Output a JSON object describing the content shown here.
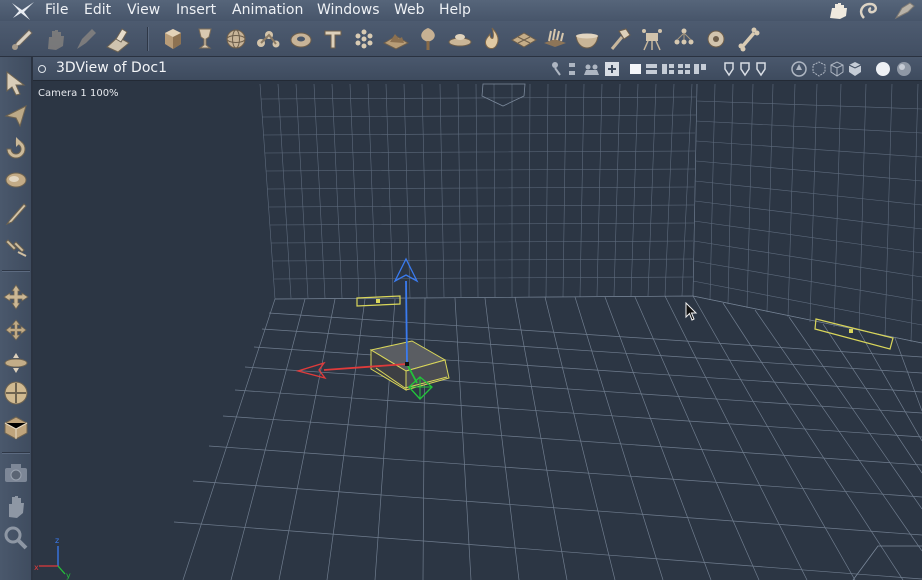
{
  "app": {
    "menus": [
      "File",
      "Edit",
      "View",
      "Insert",
      "Animation",
      "Windows",
      "Web",
      "Help"
    ]
  },
  "toolbar": {
    "left_tools": [
      "brush-icon",
      "hand-icon",
      "gesture-icon",
      "pen-stamp-icon"
    ],
    "primitive_tools": [
      "cube-icon",
      "goblet-icon",
      "sphere-icon",
      "joint-chain-icon",
      "torus-icon",
      "text-icon",
      "particle-icon",
      "terrain-icon",
      "tree-icon",
      "platter-icon",
      "fire-icon",
      "tile-icon",
      "fern-icon",
      "bowl-icon",
      "hammer-icon",
      "camera-rig-icon",
      "hierarchy-icon",
      "target-icon",
      "bone-icon"
    ]
  },
  "left_palette": {
    "tools": [
      "arrow-select-icon",
      "direct-select-icon",
      "rotate-icon",
      "twist-icon",
      "knife-icon",
      "link-icon",
      "move-icon",
      "move-xz-icon",
      "move-y-icon",
      "trackball-icon",
      "box-scale-icon",
      "camera-icon",
      "hand-pan-icon",
      "zoom-icon"
    ]
  },
  "viewport": {
    "title": "3DView of Doc1",
    "camera_label": "Camera 1 100%",
    "axis_labels": {
      "x": "x",
      "y": "y",
      "z": "z"
    },
    "colors": {
      "background": "#2c3644",
      "grid": "#7d8b9d",
      "selection": "#d9d65a",
      "axis_x": "#e03b3b",
      "axis_y": "#22c43a",
      "axis_z": "#3a7bf0"
    }
  }
}
